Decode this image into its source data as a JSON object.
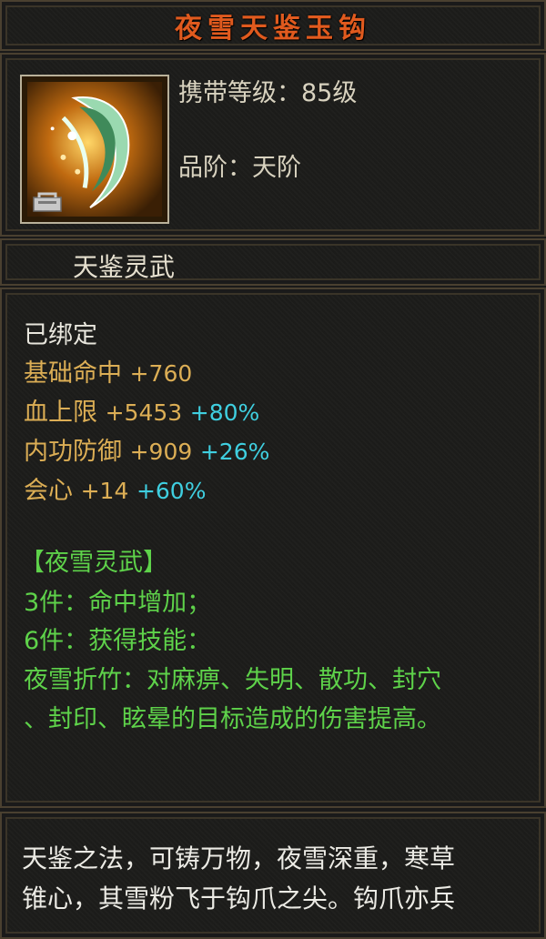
{
  "item": {
    "title": "夜雪天鉴玉钩",
    "level_label": "携带等级：",
    "level_value": "85级",
    "grade_label": "品阶：",
    "grade_value": "天阶",
    "subtitle": "天鉴灵武",
    "icon": "jade-hook-weapon-icon",
    "lock_icon": "bind-lock-icon"
  },
  "stats": {
    "bound": "已绑定",
    "rows": [
      {
        "name": "基础命中",
        "value": "+760",
        "bonus": ""
      },
      {
        "name": "血上限",
        "value": "+5453",
        "bonus": "+80%"
      },
      {
        "name": "内功防御",
        "value": "+909",
        "bonus": "+26%"
      },
      {
        "name": "会心",
        "value": "+14",
        "bonus": "+60%"
      }
    ]
  },
  "set": {
    "name": "【夜雪灵武】",
    "piece3": "3件：命中增加；",
    "piece6": "6件：获得技能：",
    "skill_line1": "夜雪折竹：对麻痹、失明、散功、封穴",
    "skill_line2": "、封印、眩晕的目标造成的伤害提高。"
  },
  "description": {
    "line1": "天鉴之法，可铸万物，夜雪深重，寒草",
    "line2": "锥心，其雪粉飞于钩爪之尖。钩爪亦兵"
  },
  "colors": {
    "title": "#e05a1e",
    "stat_name": "#dcae55",
    "bonus": "#3fcfe0",
    "set_text": "#5ed24a",
    "border": "#4a4030"
  }
}
